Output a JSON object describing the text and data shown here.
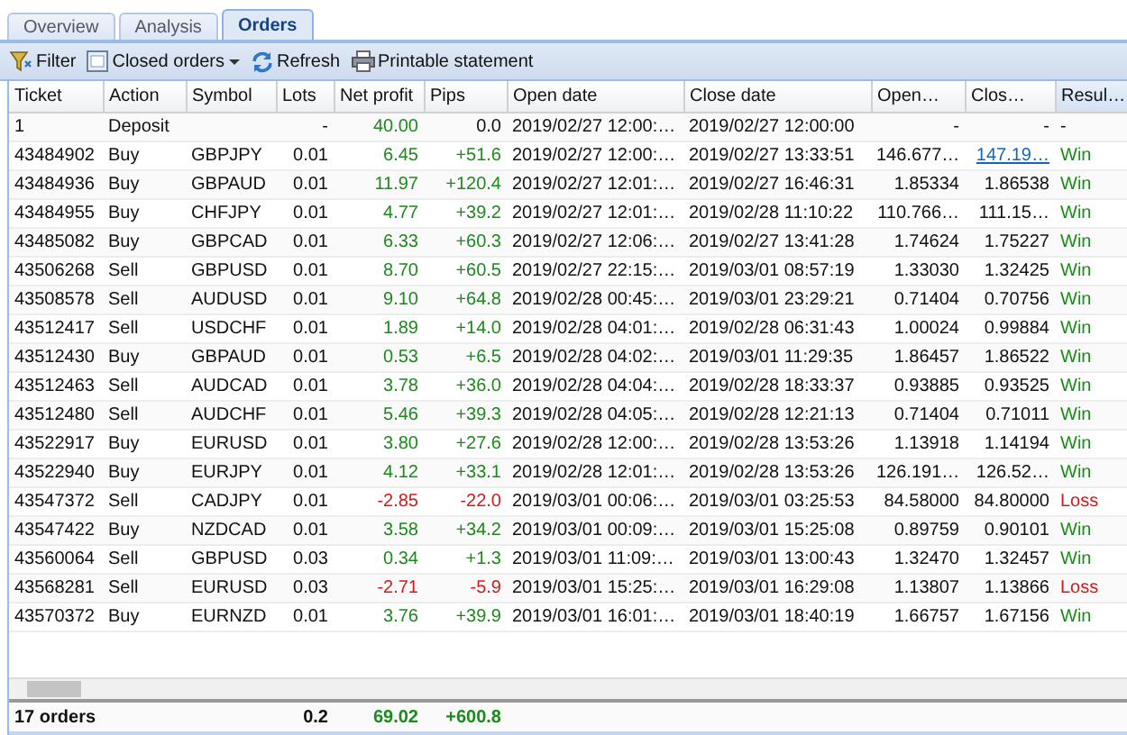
{
  "tabs": [
    {
      "label": "Overview",
      "selected": false
    },
    {
      "label": "Analysis",
      "selected": false
    },
    {
      "label": "Orders",
      "selected": true
    }
  ],
  "toolbar": [
    {
      "kind": "filter",
      "label": "Filter"
    },
    {
      "kind": "dropdown",
      "label": "Closed orders"
    },
    {
      "kind": "refresh",
      "label": "Refresh"
    },
    {
      "kind": "print",
      "label": "Printable statement"
    }
  ],
  "columns": [
    "Ticket",
    "Action",
    "Symbol",
    "Lots",
    "Net profit",
    "Pips",
    "Open date",
    "Close date",
    "Open…",
    "Clos…",
    "Resul…"
  ],
  "rows": [
    {
      "ticket": "1",
      "action": "Deposit",
      "symbol": "",
      "lots": "-",
      "net_profit": "40.00",
      "pips": "0.0",
      "open_date": "2019/02/27 12:00:…",
      "close_date": "2019/02/27 12:00:00",
      "open_price": "-",
      "close_price": "-",
      "close_price_hovered": false,
      "result": "-",
      "win": false,
      "loss": false
    },
    {
      "ticket": "43484902",
      "action": "Buy",
      "symbol": "GBPJPY",
      "lots": "0.01",
      "net_profit": "6.45",
      "pips": "+51.6",
      "open_date": "2019/02/27 12:00:…",
      "close_date": "2019/02/27 13:33:51",
      "open_price": "146.677…",
      "close_price": "147.19…",
      "close_price_hovered": true,
      "result": "Win",
      "win": true,
      "loss": false
    },
    {
      "ticket": "43484936",
      "action": "Buy",
      "symbol": "GBPAUD",
      "lots": "0.01",
      "net_profit": "11.97",
      "pips": "+120.4",
      "open_date": "2019/02/27 12:01:…",
      "close_date": "2019/02/27 16:46:31",
      "open_price": "1.85334",
      "close_price": "1.86538",
      "close_price_hovered": false,
      "result": "Win",
      "win": true,
      "loss": false
    },
    {
      "ticket": "43484955",
      "action": "Buy",
      "symbol": "CHFJPY",
      "lots": "0.01",
      "net_profit": "4.77",
      "pips": "+39.2",
      "open_date": "2019/02/27 12:01:…",
      "close_date": "2019/02/28 11:10:22",
      "open_price": "110.766…",
      "close_price": "111.15…",
      "close_price_hovered": false,
      "result": "Win",
      "win": true,
      "loss": false
    },
    {
      "ticket": "43485082",
      "action": "Buy",
      "symbol": "GBPCAD",
      "lots": "0.01",
      "net_profit": "6.33",
      "pips": "+60.3",
      "open_date": "2019/02/27 12:06:…",
      "close_date": "2019/02/27 13:41:28",
      "open_price": "1.74624",
      "close_price": "1.75227",
      "close_price_hovered": false,
      "result": "Win",
      "win": true,
      "loss": false
    },
    {
      "ticket": "43506268",
      "action": "Sell",
      "symbol": "GBPUSD",
      "lots": "0.01",
      "net_profit": "8.70",
      "pips": "+60.5",
      "open_date": "2019/02/27 22:15:…",
      "close_date": "2019/03/01 08:57:19",
      "open_price": "1.33030",
      "close_price": "1.32425",
      "close_price_hovered": false,
      "result": "Win",
      "win": true,
      "loss": false
    },
    {
      "ticket": "43508578",
      "action": "Sell",
      "symbol": "AUDUSD",
      "lots": "0.01",
      "net_profit": "9.10",
      "pips": "+64.8",
      "open_date": "2019/02/28 00:45:…",
      "close_date": "2019/03/01 23:29:21",
      "open_price": "0.71404",
      "close_price": "0.70756",
      "close_price_hovered": false,
      "result": "Win",
      "win": true,
      "loss": false
    },
    {
      "ticket": "43512417",
      "action": "Sell",
      "symbol": "USDCHF",
      "lots": "0.01",
      "net_profit": "1.89",
      "pips": "+14.0",
      "open_date": "2019/02/28 04:01:…",
      "close_date": "2019/02/28 06:31:43",
      "open_price": "1.00024",
      "close_price": "0.99884",
      "close_price_hovered": false,
      "result": "Win",
      "win": true,
      "loss": false
    },
    {
      "ticket": "43512430",
      "action": "Buy",
      "symbol": "GBPAUD",
      "lots": "0.01",
      "net_profit": "0.53",
      "pips": "+6.5",
      "open_date": "2019/02/28 04:02:…",
      "close_date": "2019/03/01 11:29:35",
      "open_price": "1.86457",
      "close_price": "1.86522",
      "close_price_hovered": false,
      "result": "Win",
      "win": true,
      "loss": false
    },
    {
      "ticket": "43512463",
      "action": "Sell",
      "symbol": "AUDCAD",
      "lots": "0.01",
      "net_profit": "3.78",
      "pips": "+36.0",
      "open_date": "2019/02/28 04:04:…",
      "close_date": "2019/02/28 18:33:37",
      "open_price": "0.93885",
      "close_price": "0.93525",
      "close_price_hovered": false,
      "result": "Win",
      "win": true,
      "loss": false
    },
    {
      "ticket": "43512480",
      "action": "Sell",
      "symbol": "AUDCHF",
      "lots": "0.01",
      "net_profit": "5.46",
      "pips": "+39.3",
      "open_date": "2019/02/28 04:05:…",
      "close_date": "2019/02/28 12:21:13",
      "open_price": "0.71404",
      "close_price": "0.71011",
      "close_price_hovered": false,
      "result": "Win",
      "win": true,
      "loss": false
    },
    {
      "ticket": "43522917",
      "action": "Buy",
      "symbol": "EURUSD",
      "lots": "0.01",
      "net_profit": "3.80",
      "pips": "+27.6",
      "open_date": "2019/02/28 12:00:…",
      "close_date": "2019/02/28 13:53:26",
      "open_price": "1.13918",
      "close_price": "1.14194",
      "close_price_hovered": false,
      "result": "Win",
      "win": true,
      "loss": false
    },
    {
      "ticket": "43522940",
      "action": "Buy",
      "symbol": "EURJPY",
      "lots": "0.01",
      "net_profit": "4.12",
      "pips": "+33.1",
      "open_date": "2019/02/28 12:01:…",
      "close_date": "2019/02/28 13:53:26",
      "open_price": "126.191…",
      "close_price": "126.52…",
      "close_price_hovered": false,
      "result": "Win",
      "win": true,
      "loss": false
    },
    {
      "ticket": "43547372",
      "action": "Sell",
      "symbol": "CADJPY",
      "lots": "0.01",
      "net_profit": "-2.85",
      "pips": "-22.0",
      "open_date": "2019/03/01 00:06:…",
      "close_date": "2019/03/01 03:25:53",
      "open_price": "84.58000",
      "close_price": "84.80000",
      "close_price_hovered": false,
      "result": "Loss",
      "win": false,
      "loss": true
    },
    {
      "ticket": "43547422",
      "action": "Buy",
      "symbol": "NZDCAD",
      "lots": "0.01",
      "net_profit": "3.58",
      "pips": "+34.2",
      "open_date": "2019/03/01 00:09:…",
      "close_date": "2019/03/01 15:25:08",
      "open_price": "0.89759",
      "close_price": "0.90101",
      "close_price_hovered": false,
      "result": "Win",
      "win": true,
      "loss": false
    },
    {
      "ticket": "43560064",
      "action": "Sell",
      "symbol": "GBPUSD",
      "lots": "0.03",
      "net_profit": "0.34",
      "pips": "+1.3",
      "open_date": "2019/03/01 11:09:…",
      "close_date": "2019/03/01 13:00:43",
      "open_price": "1.32470",
      "close_price": "1.32457",
      "close_price_hovered": false,
      "result": "Win",
      "win": true,
      "loss": false
    },
    {
      "ticket": "43568281",
      "action": "Sell",
      "symbol": "EURUSD",
      "lots": "0.03",
      "net_profit": "-2.71",
      "pips": "-5.9",
      "open_date": "2019/03/01 15:25:…",
      "close_date": "2019/03/01 16:29:08",
      "open_price": "1.13807",
      "close_price": "1.13866",
      "close_price_hovered": false,
      "result": "Loss",
      "win": false,
      "loss": true
    },
    {
      "ticket": "43570372",
      "action": "Buy",
      "symbol": "EURNZD",
      "lots": "0.01",
      "net_profit": "3.76",
      "pips": "+39.9",
      "open_date": "2019/03/01 16:01:…",
      "close_date": "2019/03/01 18:40:19",
      "open_price": "1.66757",
      "close_price": "1.67156",
      "close_price_hovered": false,
      "result": "Win",
      "win": true,
      "loss": false
    }
  ],
  "footer": {
    "count": "17 orders",
    "lots": "0.2",
    "net_profit": "69.02",
    "pips": "+600.8"
  }
}
